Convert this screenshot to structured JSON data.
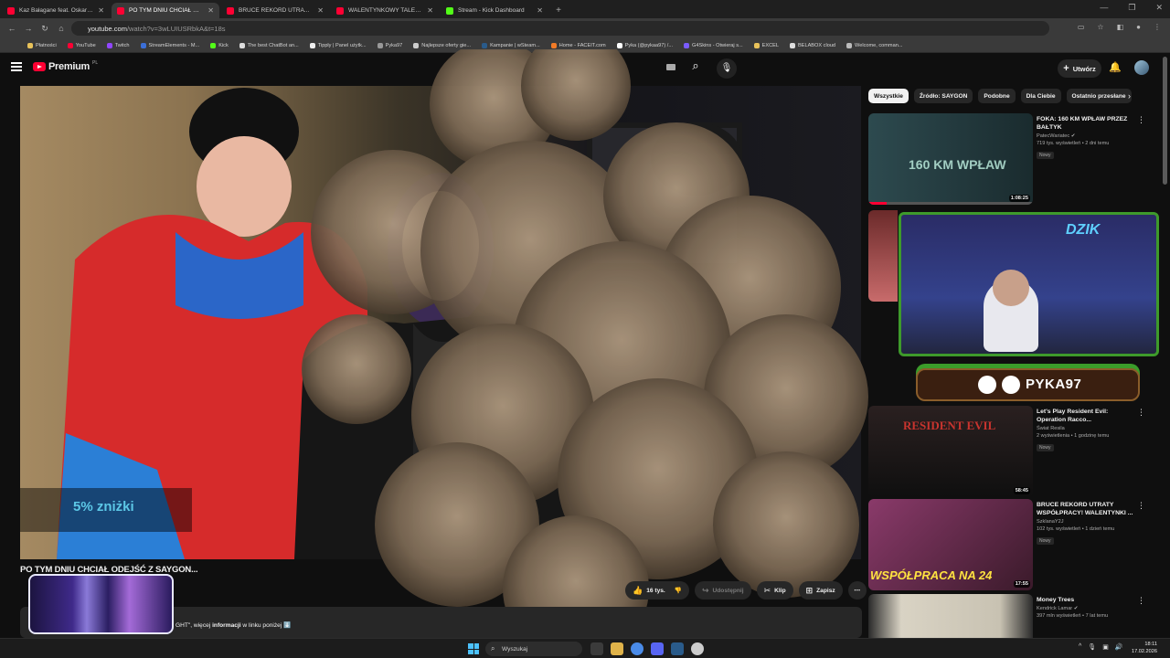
{
  "browser": {
    "tabs": [
      {
        "title": "Kaz Bałagane feat. Oskar83 - M",
        "active": false
      },
      {
        "title": "PO TYM DNIU CHCIAŁ ODEJŚĆ",
        "active": true
      },
      {
        "title": "BRUCE REKORD UTRATY WSPÓ",
        "active": false
      },
      {
        "title": "WALENTYNKOWY TALERZ 5K",
        "active": false
      },
      {
        "title": "Stream - Kick Dashboard",
        "active": false
      }
    ],
    "url_host": "youtube.com",
    "url_path": "/watch?v=3wLUIUSRbkA&t=18s",
    "bookmarks": [
      "Płatności",
      "YouTube",
      "Twitch",
      "StreamElements - M...",
      "Kick",
      "The best ChatBot an...",
      "Tipply | Panel użytk...",
      "Pyka97",
      "Najlepsze oferty gie...",
      "Kampanie | wSteam...",
      "Home - FACEIT.com",
      "Pyka (@pykaa97) /...",
      "G4Skins - Otwieraj s...",
      "EXCEL",
      "BELABOX cloud",
      "Welcome, comman..."
    ]
  },
  "youtube": {
    "logo_text": "Premium",
    "logo_region": "PL",
    "create_label": "Utwórz",
    "video": {
      "title": "PO TYM DNIU CHCIAŁ ODEJŚĆ Z SAYGON...",
      "discount_text": "5% zniżki",
      "description_tail": "GHT\", więcej ",
      "description_bold": "informacji",
      "description_rest": " w linku poniżej ⬇️",
      "actions": {
        "likes": "16 tys.",
        "share": "Udostępnij",
        "clip": "Klip",
        "save": "Zapisz"
      }
    },
    "chips": [
      "Wszystkie",
      "Źródło: SAYGON",
      "Podobne",
      "Dla Ciebie",
      "Ostatnio przesłane"
    ],
    "recommendations": [
      {
        "title": "FOKA: 160 KM WPŁAW PRZEZ BAŁTYK",
        "channel": "PatecWariatec",
        "views": "719 tys. wyświetleń • 2 dni temu",
        "badge": "Nowy",
        "duration": "1:08:25",
        "thumb_text": "160 KM WPŁAW"
      },
      {
        "title": "Let's Play Resident Evil: Operation Racco...",
        "channel": "Świat Resila",
        "views": "2 wyświetlenia • 1 godzinę temu",
        "badge": "Nowy",
        "duration": "58:45",
        "thumb_text": "RESIDENT EVIL"
      },
      {
        "title": "BRUCE REKORD UTRATY WSPÓŁPRACY! WALENTYNKI ...",
        "channel": "SzklanaY2J",
        "views": "102 tys. wyświetleń • 1 dzień temu",
        "badge": "Nowy",
        "duration": "17:55",
        "thumb_text": "WSPÓŁPRACA NA 24"
      },
      {
        "title": "Money Trees",
        "channel": "Kendrick Lamar",
        "views": "397 mln wyświetleń • 7 lat temu",
        "badge": "",
        "duration": "",
        "thumb_text": ""
      }
    ],
    "overlay": {
      "logo_text": "DZIK",
      "handle": "PYKA97"
    }
  },
  "taskbar": {
    "search_placeholder": "Wyszukaj",
    "time": "18:11",
    "date": "17.02.2026"
  },
  "colors": {
    "yt_red": "#ff0033",
    "background": "#0f0f0f",
    "chip_bg": "#272727",
    "discount_text": "#5cc7e6",
    "overlay_border": "#3e9a2b"
  }
}
